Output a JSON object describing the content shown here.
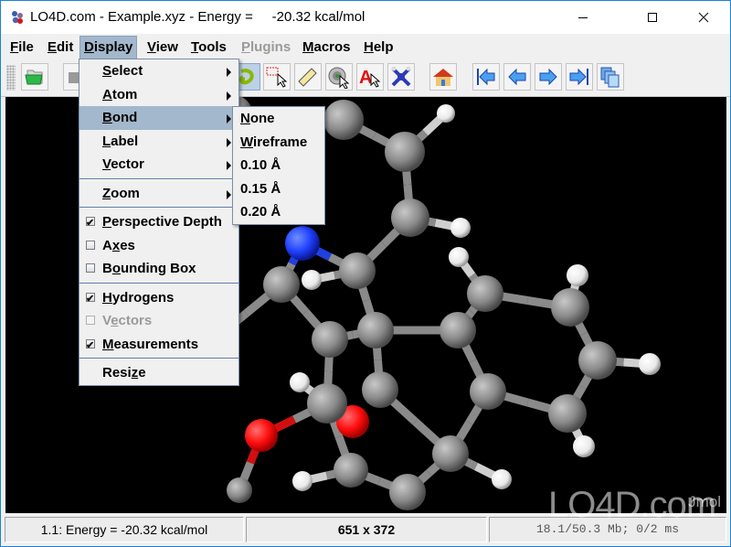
{
  "window": {
    "title": "LO4D.com - Example.xyz - Energy =     -20.32 kcal/mol",
    "controls": {
      "minimize": "minimize-icon",
      "maximize": "maximize-icon",
      "close": "close-icon"
    }
  },
  "menubar": {
    "items": [
      {
        "label": "File",
        "mnemonic": "F",
        "rest": "ile",
        "state": "normal"
      },
      {
        "label": "Edit",
        "mnemonic": "E",
        "rest": "dit",
        "state": "normal"
      },
      {
        "label": "Display",
        "mnemonic": "D",
        "rest": "isplay",
        "state": "active"
      },
      {
        "label": "View",
        "mnemonic": "V",
        "rest": "iew",
        "state": "normal"
      },
      {
        "label": "Tools",
        "mnemonic": "T",
        "rest": "ools",
        "state": "normal"
      },
      {
        "label": "Plugins",
        "mnemonic": "P",
        "rest": "lugins",
        "state": "disabled"
      },
      {
        "label": "Macros",
        "mnemonic": "M",
        "rest": "acros",
        "state": "normal"
      },
      {
        "label": "Help",
        "mnemonic": "H",
        "rest": "elp",
        "state": "normal"
      }
    ]
  },
  "toolbar": {
    "buttons": [
      {
        "icon": "open-folder-icon"
      },
      {
        "icon": "camera-icon"
      },
      {
        "icon": "rotate-icon",
        "pressed": true
      },
      {
        "icon": "select-region-icon"
      },
      {
        "icon": "ruler-icon"
      },
      {
        "icon": "spin-pick-icon"
      },
      {
        "icon": "label-pick-icon"
      },
      {
        "icon": "molecule-drag-icon"
      },
      {
        "icon": "home-icon"
      },
      {
        "icon": "first-frame-icon"
      },
      {
        "icon": "previous-frame-icon"
      },
      {
        "icon": "next-frame-icon"
      },
      {
        "icon": "last-frame-icon"
      },
      {
        "icon": "copy-pages-icon"
      }
    ]
  },
  "display_menu": {
    "items": [
      {
        "pre": "",
        "mn": "S",
        "post": "elect",
        "submenu": true
      },
      {
        "pre": "",
        "mn": "A",
        "post": "tom",
        "submenu": true
      },
      {
        "pre": "",
        "mn": "B",
        "post": "ond",
        "submenu": true,
        "highlighted": true
      },
      {
        "pre": "",
        "mn": "L",
        "post": "abel",
        "submenu": true
      },
      {
        "pre": "",
        "mn": "V",
        "post": "ector",
        "submenu": true
      },
      {
        "separator": true
      },
      {
        "pre": "",
        "mn": "Z",
        "post": "oom",
        "submenu": true
      },
      {
        "separator": true
      },
      {
        "pre": "",
        "mn": "P",
        "post": "erspective Depth",
        "checkbox": true,
        "checked": true
      },
      {
        "pre": "A",
        "mn": "x",
        "post": "es",
        "checkbox": true,
        "checked": false
      },
      {
        "pre": "B",
        "mn": "o",
        "post": "unding Box",
        "checkbox": true,
        "checked": false
      },
      {
        "separator": true
      },
      {
        "pre": "",
        "mn": "H",
        "post": "ydrogens",
        "checkbox": true,
        "checked": true
      },
      {
        "pre": "V",
        "mn": "e",
        "post": "ctors",
        "checkbox": true,
        "checked": false,
        "disabled": true
      },
      {
        "pre": "",
        "mn": "M",
        "post": "easurements",
        "checkbox": true,
        "checked": true
      },
      {
        "separator": true
      },
      {
        "pre": "Resi",
        "mn": "z",
        "post": "e"
      }
    ]
  },
  "bond_submenu": {
    "items": [
      {
        "pre": "",
        "mn": "N",
        "post": "one"
      },
      {
        "pre": "",
        "mn": "W",
        "post": "ireframe"
      },
      {
        "pre": "0.10 Å",
        "mn": "",
        "post": ""
      },
      {
        "pre": "0.15 Å",
        "mn": "",
        "post": ""
      },
      {
        "pre": "0.20 Å",
        "mn": "",
        "post": ""
      }
    ]
  },
  "viewer": {
    "watermark_label": "Jmol",
    "colors": {
      "carbon": "#8c8c8c",
      "hydrogen": "#ffffff",
      "nitrogen": "#2040ff",
      "oxygen": "#ff0d0d",
      "background": "#000000"
    }
  },
  "statusbar": {
    "energy": "1.1: Energy =     -20.32 kcal/mol",
    "dimensions": "651 x 372",
    "memory": "18.1/50.3 Mb;   0/2 ms"
  },
  "brand_watermark": "LO4D.com"
}
